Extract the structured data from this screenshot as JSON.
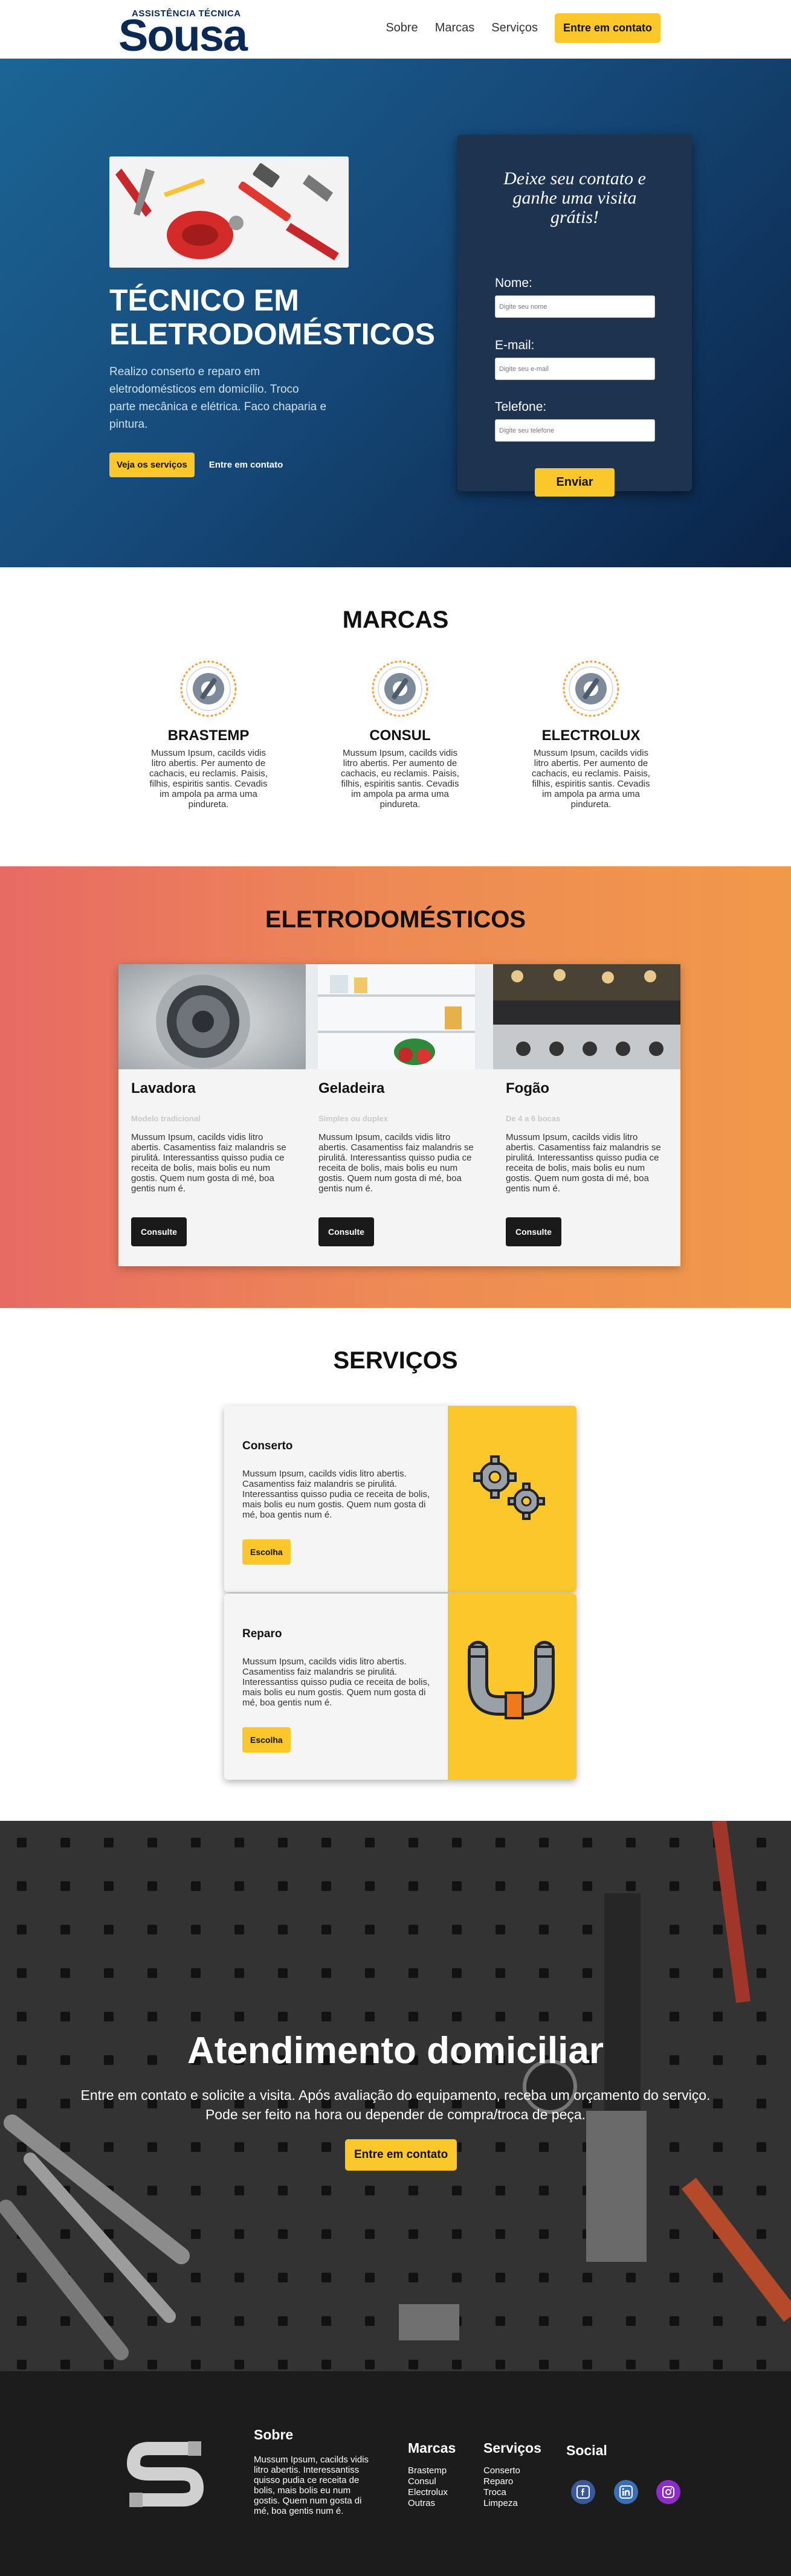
{
  "logo": {
    "subtitle": "ASSISTÊNCIA TÉCNICA",
    "main": "Sousa"
  },
  "nav": {
    "links": [
      "Sobre",
      "Marcas",
      "Serviços"
    ],
    "cta": "Entre em contato"
  },
  "hero": {
    "title": "TÉCNICO EM ELETRODOMÉSTICOS",
    "text": "Realizo conserto e reparo em eletrodomésticos em domicílio. Troco parte mecânica e elétrica. Faco chaparia e pintura.",
    "primary_button": "Veja os serviços",
    "secondary_button": "Entre em contato"
  },
  "form": {
    "title": "Deixe seu contato e ganhe uma visita grátis!",
    "name_label": "Nome:",
    "name_placeholder": "Digite seu nome",
    "email_label": "E-mail:",
    "email_placeholder": "Digite seu e-mail",
    "phone_label": "Telefone:",
    "phone_placeholder": "Digite seu telefone",
    "submit": "Enviar"
  },
  "marcas": {
    "title": "MARCAS",
    "items": [
      {
        "name": "BRASTEMP",
        "text": "Mussum Ipsum, cacilds vidis litro abertis. Per aumento de cachacis, eu reclamis. Paisis, filhis, espiritis santis. Cevadis im ampola pa arma uma pindureta."
      },
      {
        "name": "CONSUL",
        "text": "Mussum Ipsum, cacilds vidis litro abertis. Per aumento de cachacis, eu reclamis. Paisis, filhis, espiritis santis. Cevadis im ampola pa arma uma pindureta."
      },
      {
        "name": "ELECTROLUX",
        "text": "Mussum Ipsum, cacilds vidis litro abertis. Per aumento de cachacis, eu reclamis. Paisis, filhis, espiritis santis. Cevadis im ampola pa arma uma pindureta."
      }
    ],
    "icon_color": "#f0a24a"
  },
  "eletro": {
    "title": "ELETRODOMÉSTICOS",
    "cards": [
      {
        "title": "Lavadora",
        "subtitle": "Modelo tradicional",
        "text": "Mussum Ipsum, cacilds vidis litro abertis. Casamentiss faiz malandris se pirulitá. Interessantiss quisso pudia ce receita de bolis, mais bolis eu num gostis. Quem num gosta di mé, boa gentis num é.",
        "button": "Consulte"
      },
      {
        "title": "Geladeira",
        "subtitle": "Simples ou duplex",
        "text": "Mussum Ipsum, cacilds vidis litro abertis. Casamentiss faiz malandris se pirulitá. Interessantiss quisso pudia ce receita de bolis, mais bolis eu num gostis. Quem num gosta di mé, boa gentis num é.",
        "button": "Consulte"
      },
      {
        "title": "Fogão",
        "subtitle": "De 4 a 6 bocas",
        "text": "Mussum Ipsum, cacilds vidis litro abertis. Casamentiss faiz malandris se pirulitá. Interessantiss quisso pudia ce receita de bolis, mais bolis eu num gostis. Quem num gosta di mé, boa gentis num é.",
        "button": "Consulte"
      }
    ]
  },
  "servicos": {
    "title": "SERVIÇOS",
    "items": [
      {
        "title": "Conserto",
        "text": "Mussum Ipsum, cacilds vidis litro abertis. Casamentiss faiz malandris se pirulitá. Interessantiss quisso pudia ce receita de bolis, mais bolis eu num gostis. Quem num gosta di mé, boa gentis num é.",
        "button": "Escolha",
        "icon": "gears-icon"
      },
      {
        "title": "Reparo",
        "text": "Mussum Ipsum, cacilds vidis litro abertis. Casamentiss faiz malandris se pirulitá. Interessantiss quisso pudia ce receita de bolis, mais bolis eu num gostis. Quem num gosta di mé, boa gentis num é.",
        "button": "Escolha",
        "icon": "pipe-icon"
      }
    ]
  },
  "atendimento": {
    "title": "Atendimento domiciliar",
    "text_line1": "Entre em contato e solicite a visita. Após avaliação do equipamento, receba um orçamento do serviço.",
    "text_line2": "Pode ser feito na hora ou depender de compra/troca de peça.",
    "button": "Entre em contato"
  },
  "footer": {
    "sobre_title": "Sobre",
    "sobre_text": "Mussum Ipsum, cacilds vidis litro abertis. Interessantiss quisso pudia ce receita de bolis, mais bolis eu num gostis. Quem num gosta di mé, boa gentis num é.",
    "marcas_title": "Marcas",
    "marcas": [
      "Brastemp",
      "Consul",
      "Electrolux",
      "Outras"
    ],
    "servicos_title": "Serviços",
    "servicos": [
      "Conserto",
      "Reparo",
      "Troca",
      "Limpeza"
    ],
    "social_title": "Social",
    "social_icons": [
      "facebook-icon",
      "linkedin-icon",
      "instagram-icon"
    ]
  },
  "colors": {
    "accent": "#fcc72b",
    "navy": "#0a2a55",
    "footer_bg": "#1c1c1c"
  }
}
